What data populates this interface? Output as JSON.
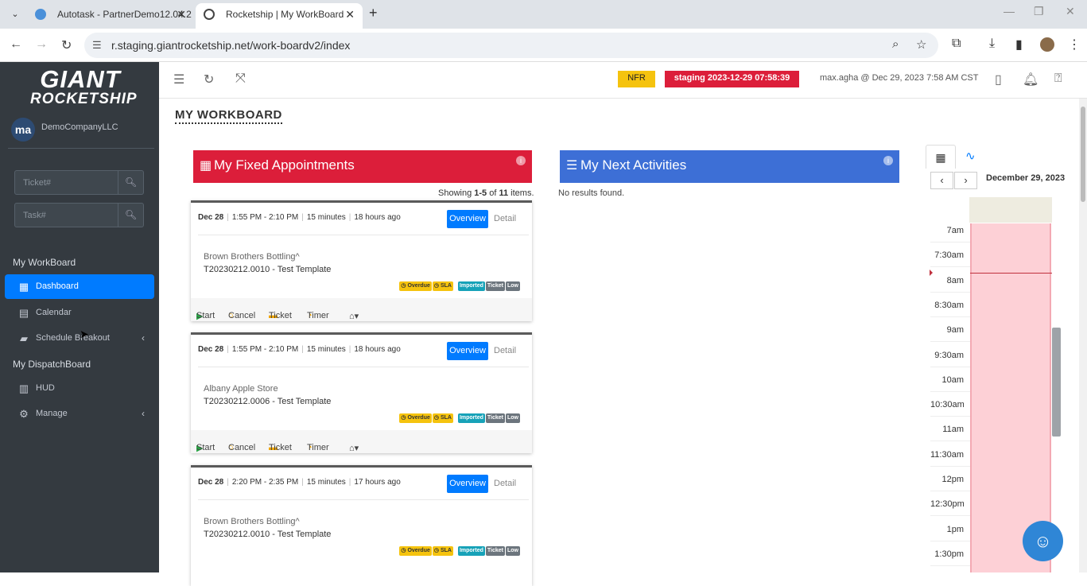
{
  "browser": {
    "tabs": [
      {
        "title": "Autotask - PartnerDemo12.04.2"
      },
      {
        "title": "Rocketship | My WorkBoard"
      }
    ],
    "url": "r.staging.giantrocketship.net/work-boardv2/index"
  },
  "sidebar": {
    "logo_line1": "GIANT",
    "logo_line2": "ROCKETSHIP",
    "company_initials": "ma",
    "company_name": "DemoCompanyLLC",
    "ticket_placeholder": "Ticket#",
    "task_placeholder": "Task#",
    "section1": "My WorkBoard",
    "section2": "My DispatchBoard",
    "items": [
      {
        "label": "Dashboard"
      },
      {
        "label": "Calendar"
      },
      {
        "label": "Schedule Breakout"
      },
      {
        "label": "HUD"
      },
      {
        "label": "Manage"
      }
    ]
  },
  "header": {
    "nfr": "NFR",
    "staging": "staging 2023-12-29 07:58:39",
    "user": "max.agha @ Dec 29, 2023 7:58 AM CST"
  },
  "page": {
    "title": "MY WORKBOARD",
    "fixed_title": "My Fixed Appointments",
    "next_title": "My Next Activities",
    "showing_prefix": "Showing ",
    "showing_range": "1-5",
    "showing_of": " of ",
    "showing_total": "11",
    "showing_suffix": " items.",
    "no_results": "No results found."
  },
  "appointments": [
    {
      "date": "Dec 28",
      "time": "1:55 PM - 2:10 PM",
      "duration": "15 minutes",
      "ago": "18 hours ago",
      "account": "Brown Brothers Bottling^",
      "ticket": "T20230212.0010 - Test Template"
    },
    {
      "date": "Dec 28",
      "time": "1:55 PM - 2:10 PM",
      "duration": "15 minutes",
      "ago": "18 hours ago",
      "account": "Albany Apple Store",
      "ticket": "T20230212.0006 - Test Template"
    },
    {
      "date": "Dec 28",
      "time": "2:20 PM - 2:35 PM",
      "duration": "15 minutes",
      "ago": "17 hours ago",
      "account": "Brown Brothers Bottling^",
      "ticket": "T20230212.0010 - Test Template"
    }
  ],
  "appt_labels": {
    "overview": "Overview",
    "detail": "Detail",
    "overdue": "Overdue",
    "sla": "SLA",
    "imported": "Imported",
    "ticket_badge": "Ticket",
    "low": "Low",
    "start": "Start",
    "cancel": "Cancel",
    "ticket": "Ticket",
    "timer": "Timer"
  },
  "calendar": {
    "date": "December 29, 2023",
    "times": [
      "7am",
      "7:30am",
      "8am",
      "8:30am",
      "9am",
      "9:30am",
      "10am",
      "10:30am",
      "11am",
      "11:30am",
      "12pm",
      "12:30pm",
      "1pm",
      "1:30pm"
    ]
  },
  "colors": {
    "red": "#dc1e3a",
    "blue": "#3d6fd6",
    "accent": "#007bff",
    "sidebar": "#343a40"
  }
}
